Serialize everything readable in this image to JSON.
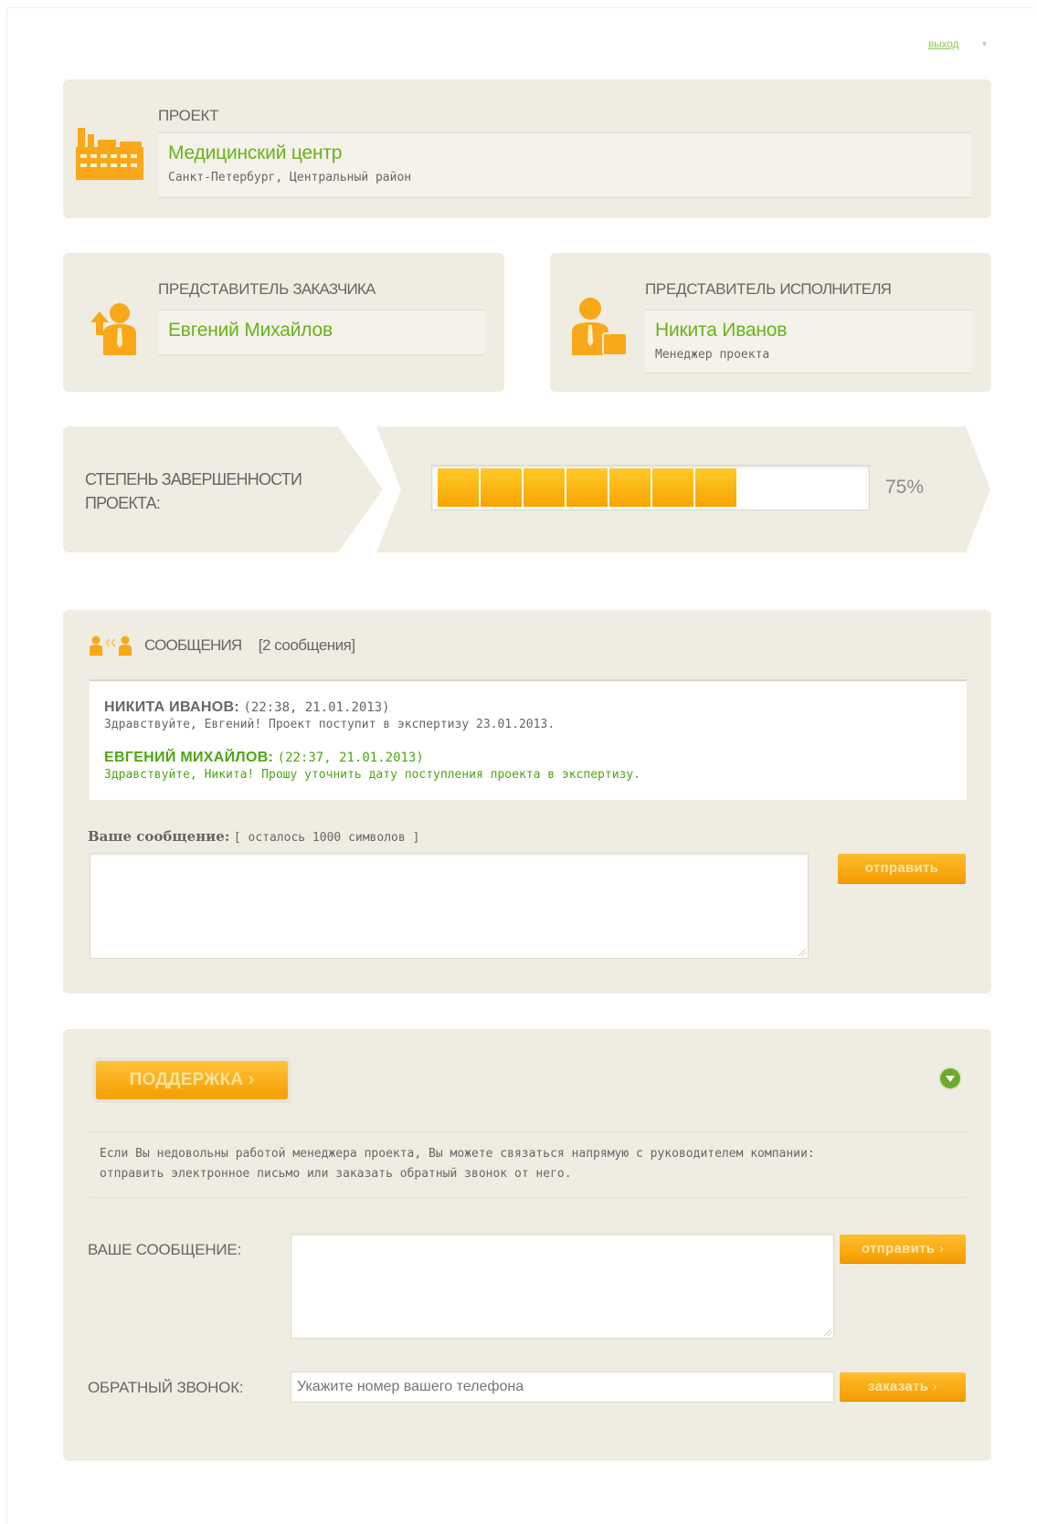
{
  "header": {
    "logout_label": "выход"
  },
  "project": {
    "section_title": "ПРОЕКТ",
    "name": "Медицинский центр",
    "location": "Санкт-Петербург, Центральный район"
  },
  "customer_rep": {
    "section_title_prefix": "ПРЕДСТАВИТЕЛЬ ",
    "section_title_bold": "ЗАКАЗЧИКА",
    "name": "Евгений Михайлов"
  },
  "contractor_rep": {
    "section_title_prefix": "ПРЕДСТАВИТЕЛЬ ",
    "section_title_bold": "ИСПОЛНИТЕЛЯ",
    "name": "Никита Иванов",
    "role": "Менеджер проекта"
  },
  "progress": {
    "label_line1": "СТЕПЕНЬ ЗАВЕРШЕННОСТИ",
    "label_line2": "ПРОЕКТА:",
    "percent_label": "75%",
    "value": 0.75,
    "segments_filled": 7
  },
  "messages": {
    "title": "СООБЩЕНИЯ",
    "count_label": "[2 сообщения]",
    "items": [
      {
        "author": "НИКИТА ИВАНОВ:",
        "time": "(22:38, 21.01.2013)",
        "text": "Здравствуйте, Евгений! Проект поступит в экспертизу 23.01.2013.",
        "color": "#666666"
      },
      {
        "author": "ЕВГЕНИЙ МИХАЙЛОВ:",
        "time": "(22:37, 21.01.2013)",
        "text": "Здравствуйте, Никита! Прошу уточнить дату поступления проекта в экспертизу.",
        "color": "#4fa514"
      }
    ],
    "input_label": "Ваше сообщение:",
    "chars_left": "[ осталось 1000 символов ]",
    "send_label": "отправить"
  },
  "support": {
    "button_label": "ПОДДЕРЖКА",
    "button_arrow": "›",
    "text_line1": "Если Вы недовольны работой менеджера проекта, Вы можете связаться напрямую с руководителем компании:",
    "text_line2": "отправить электронное письмо или заказать обратный звонок от него.",
    "message_label": "ВАШЕ СООБЩЕНИЕ:",
    "send_label": "отправить",
    "callback_label": "ОБРАТНЫЙ ЗВОНОК:",
    "phone_placeholder": "Укажите номер вашего телефона",
    "order_label": "заказать"
  },
  "colors": {
    "accent_orange": "#f8a400",
    "accent_green": "#6ab21a",
    "panel_bg": "#efede2"
  }
}
